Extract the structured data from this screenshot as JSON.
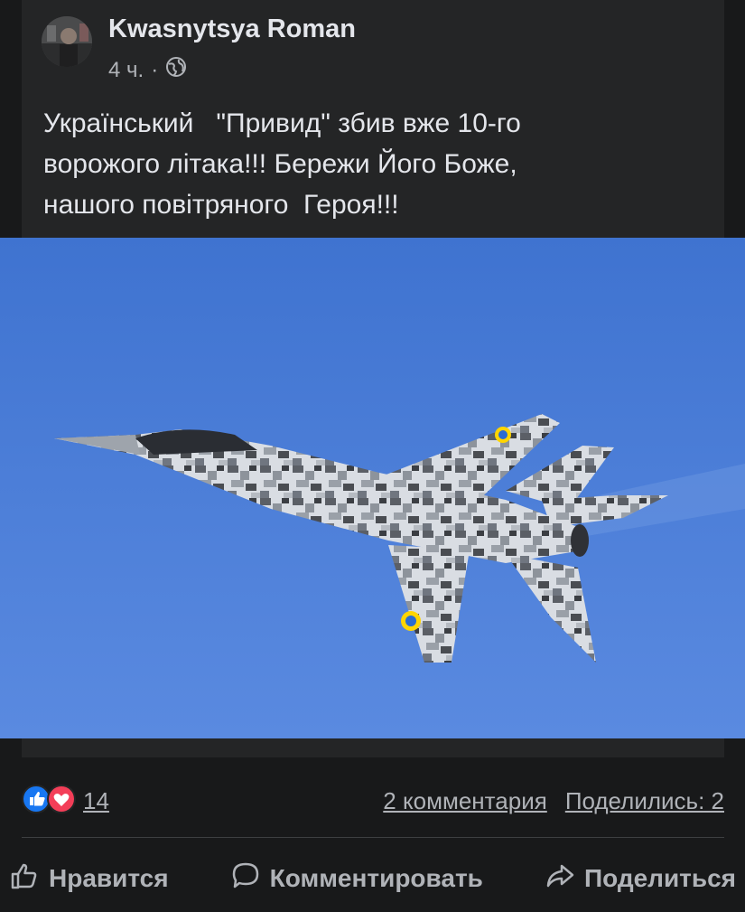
{
  "post": {
    "author": "Kwasnytsya Roman",
    "time": "4 ч.",
    "separator": "·",
    "privacy_icon": "globe-icon",
    "text": "Український   \"Привид\" збив вже 10-го\nворожого літака!!! Бережи Його Боже,\nнашого повітряного  Героя!!!"
  },
  "reactions": {
    "icons": [
      "like-reaction-icon",
      "love-reaction-icon"
    ],
    "count": "14",
    "comments": "2 комментария",
    "shares": "Поделились: 2"
  },
  "actions": {
    "like": "Нравится",
    "comment": "Комментировать",
    "share": "Поделиться"
  },
  "colors": {
    "background": "#18191a",
    "card": "#242526",
    "text": "#e4e6eb",
    "secondary": "#b0b3b8",
    "like_blue": "#1877f2",
    "love_red": "#f33e58",
    "sky": "#4d7fd6"
  }
}
